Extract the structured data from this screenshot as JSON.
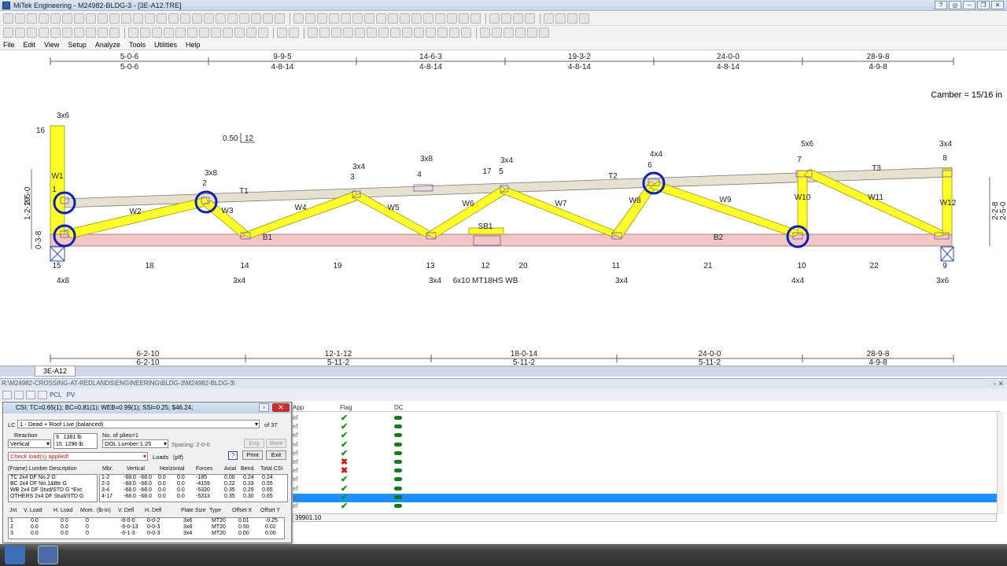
{
  "window": {
    "title": "MiTek Engineering - M24982-BLDG-3 - [3E-A12.TRE]",
    "buttons": [
      "?",
      "◎",
      "–",
      "❐",
      "✕"
    ]
  },
  "menu": [
    "File",
    "Edit",
    "View",
    "Setup",
    "Analyze",
    "Tools",
    "Utilities",
    "Help"
  ],
  "camber": "Camber = 15/16 in",
  "truss": {
    "top_dims": [
      {
        "a": "5-0-6",
        "b": "5-0-6"
      },
      {
        "a": "9-9-5",
        "b": "4-8-14"
      },
      {
        "a": "14-6-3",
        "b": "4-8-14"
      },
      {
        "a": "19-3-2",
        "b": "4-8-14"
      },
      {
        "a": "24-0-0",
        "b": "4-8-14"
      },
      {
        "a": "28-9-8",
        "b": "4-9-8"
      }
    ],
    "bottom_dims": [
      {
        "a": "6-2-10",
        "b": "6-2-10"
      },
      {
        "a": "12-1-12",
        "b": "5-11-2"
      },
      {
        "a": "18-0-14",
        "b": "5-11-2"
      },
      {
        "a": "24-0-0",
        "b": "5-11-2"
      },
      {
        "a": "28-9-8",
        "b": "4-9-8"
      }
    ],
    "pitch": {
      "rise": "0.50",
      "run": "12"
    },
    "left_heights": [
      "1-2-10",
      "2-5-0",
      "0-3-8"
    ],
    "right_heights": [
      "2-2-8",
      "2-5-0"
    ],
    "top_plates": [
      "3x6",
      "3x8",
      "3x4",
      "3x8",
      "3x4",
      "4x4",
      "5x6",
      "3x4"
    ],
    "top_joints": [
      "1",
      "2",
      "3",
      "4",
      "17",
      "5",
      "6",
      "7",
      "8"
    ],
    "member_labels": [
      "W1",
      "W2",
      "W3",
      "W4",
      "W5",
      "W6",
      "W7",
      "W8",
      "W9",
      "W10",
      "W11",
      "W12",
      "T1",
      "T2",
      "T3",
      "B1",
      "B2",
      "SB1"
    ],
    "left_height_label": "16",
    "bottom_joints": [
      "15",
      "18",
      "14",
      "19",
      "13",
      "12",
      "20",
      "11",
      "21",
      "10",
      "22",
      "9"
    ],
    "bottom_plates": [
      "4x8",
      "3x4",
      "3x4",
      "6x10 MT18HS WB",
      "3x4",
      "4x4",
      "3x6"
    ]
  },
  "sheet_tab": "3E-A12",
  "path": "R:\\M24982-CROSSING-AT-REDLANDS\\ENGINEERING\\BLDG-3\\M24982-BLDG-3\\",
  "pane_toolbar_labels": [
    "PCL",
    "PV"
  ],
  "grid": {
    "headers": [
      "App",
      "Flag",
      "DC"
    ],
    "rows": [
      {
        "app": "ef",
        "flag": "ok"
      },
      {
        "app": "ef",
        "flag": "ok"
      },
      {
        "app": "ef",
        "flag": "ok"
      },
      {
        "app": "ef",
        "flag": "ok"
      },
      {
        "app": "ef",
        "flag": "ok"
      },
      {
        "app": "ef",
        "flag": "bad"
      },
      {
        "app": "ef",
        "flag": "bad"
      },
      {
        "app": "ef",
        "flag": "ok"
      },
      {
        "app": "ef",
        "flag": "ok"
      },
      {
        "app": "ef",
        "flag": "ok",
        "selected": true
      },
      {
        "app": "ef",
        "flag": "ok"
      }
    ],
    "status": "39901.10"
  },
  "dialog": {
    "title": "CSI: TC=0.65(1); BC=0.81(1); WEB=0.99(1); SSI=0.25; $46.24;",
    "lc_label": "LC",
    "lc_value": "1 - Dead + Roof Live (balanced)",
    "lc_of": "of 37",
    "reaction_label": "Reaction",
    "reaction_type": "Vertical",
    "reactions": [
      {
        "jnt": "9",
        "val": "1381",
        "unit": "lb"
      },
      {
        "jnt": "15",
        "val": "1296",
        "unit": "lb"
      }
    ],
    "plies": "No. of plies=1",
    "dol": "DOL Lumber:1.25",
    "spacing": "Spacing: 2-0-0",
    "eng_btn": "Eng",
    "more_btn": "More",
    "print_btn": "Print",
    "exit_btn": "Exit",
    "help_btn": "?",
    "warning": "Check load(s) applied!",
    "loads_label": "Loads",
    "loads_unit": "(plf)",
    "lumber_header": [
      "(Frame) Lumber Description",
      "Mbr.",
      "Vertical",
      "Horizontal",
      "Forces",
      "Axial",
      "Bend.",
      "Total CSI"
    ],
    "lumber": [
      {
        "d": "TC  2x4 DF No.2 G",
        "m": "1-2",
        "v1": "-68.0",
        "v2": "-68.0",
        "h1": "0.0",
        "h2": "0.0",
        "f": "-185",
        "a": "0.00",
        "b": "0.24",
        "t": "0.24"
      },
      {
        "d": "BC  2x4 DF No.1&Btr G",
        "m": "2-3",
        "v1": "-68.0",
        "v2": "-68.0",
        "h1": "0.0",
        "h2": "0.0",
        "f": "-4159",
        "a": "0.22",
        "b": "0.33",
        "t": "0.55"
      },
      {
        "d": "WB  2x4 DF Stud/STD G *Exc",
        "m": "3-4",
        "v1": "-68.0",
        "v2": "-68.0",
        "h1": "0.0",
        "h2": "0.0",
        "f": "-5320",
        "a": "0.35",
        "b": "0.29",
        "t": "0.65"
      },
      {
        "d": "OTHERS  2x4 DF Stud/STD G",
        "m": "4-17",
        "v1": "-68.0",
        "v2": "-68.0",
        "h1": "0.0",
        "h2": "0.0",
        "f": "-5313",
        "a": "0.35",
        "b": "0.30",
        "t": "0.65"
      }
    ],
    "joint_header": [
      "Jnt",
      "V. Load",
      "H. Load",
      "Mom.",
      "(lb-in)",
      "V. Defl",
      "H. Defl",
      "Plate Size",
      "Type",
      "Offset X",
      "Offset Y"
    ],
    "joints": [
      {
        "j": "1",
        "vl": "0.0",
        "hl": "0.0",
        "mo": "0",
        "vd": "-0-0-0",
        "hd": "0-0-2",
        "ps": "3x6",
        "ty": "MT20",
        "ox": "0.01",
        "oy": "-0.25"
      },
      {
        "j": "2",
        "vl": "0.0",
        "hl": "0.0",
        "mo": "0",
        "vd": "-0-0-13",
        "hd": "0-0-3",
        "ps": "3x8",
        "ty": "MT20",
        "ox": "0.50",
        "oy": "0.02"
      },
      {
        "j": "3",
        "vl": "0.0",
        "hl": "0.0",
        "mo": "0",
        "vd": "-0-1-3",
        "hd": "0-0-3",
        "ps": "3x4",
        "ty": "MT20",
        "ox": "0.00",
        "oy": "0.00"
      }
    ]
  },
  "colors": {
    "web": "#ffff2a",
    "top_chord": "#e6e0cf",
    "bottom_chord": "#f3c6c6",
    "circle": "#1020b0",
    "selected_row": "#1e90ff"
  }
}
